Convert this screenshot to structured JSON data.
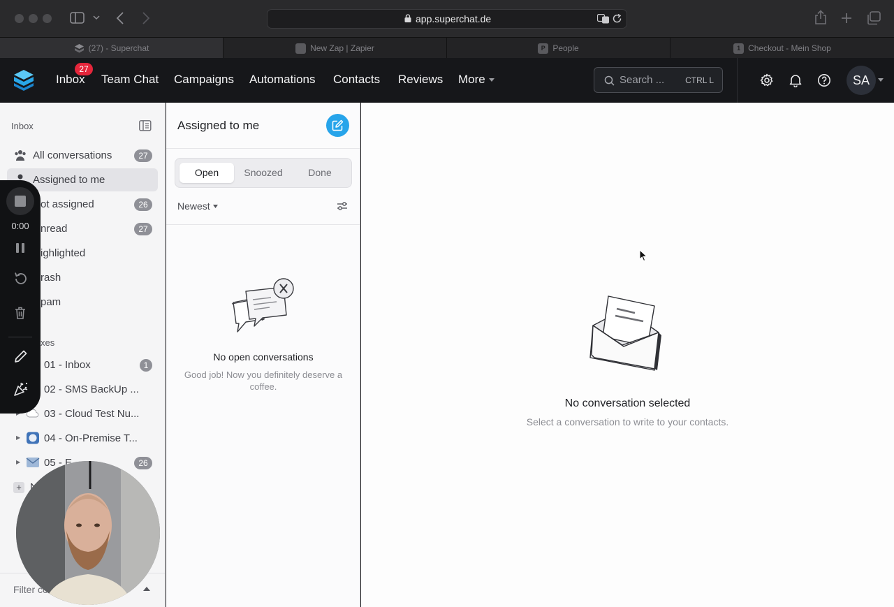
{
  "browser": {
    "url": "app.superchat.de",
    "tabs": [
      {
        "title": "(27) - Superchat",
        "favicon": "superchat-favicon"
      },
      {
        "title": "New Zap | Zapier",
        "favicon": "zapier-favicon"
      },
      {
        "title": "People",
        "favicon": "P"
      },
      {
        "title": "Checkout - Mein Shop",
        "favicon": "1"
      }
    ]
  },
  "header": {
    "nav": [
      {
        "label": "Inbox",
        "badge": "27"
      },
      {
        "label": "Team Chat"
      },
      {
        "label": "Campaigns"
      },
      {
        "label": "Automations"
      },
      {
        "label": "Contacts"
      },
      {
        "label": "Reviews"
      },
      {
        "label": "More"
      }
    ],
    "search_placeholder": "Search ...",
    "search_shortcut": "CTRL L",
    "avatar_initials": "SA"
  },
  "sidebar": {
    "title": "Inbox",
    "items": [
      {
        "label": "All conversations",
        "count": "27"
      },
      {
        "label": "Assigned to me",
        "count": ""
      },
      {
        "label": "ot assigned",
        "count": "26"
      },
      {
        "label": "nread",
        "count": "27"
      },
      {
        "label": "ighlighted",
        "count": ""
      },
      {
        "label": "rash",
        "count": ""
      },
      {
        "label": "pam",
        "count": ""
      }
    ],
    "inboxes_heading": "xes",
    "inboxes": [
      {
        "label": "01 - Inbox",
        "count": "1"
      },
      {
        "label": "02 - SMS BackUp ...",
        "count": ""
      },
      {
        "label": "03 - Cloud Test Nu...",
        "count": ""
      },
      {
        "label": "04 - On-Premise T...",
        "count": ""
      },
      {
        "label": "05 - E",
        "count": "26"
      }
    ],
    "add_label": "N",
    "filter_label": "Filter co"
  },
  "conversation_list": {
    "title": "Assigned to me",
    "tabs": [
      "Open",
      "Snoozed",
      "Done"
    ],
    "active_tab": "Open",
    "sort_label": "Newest",
    "empty_title": "No open conversations",
    "empty_text": "Good job! Now you definitely deserve a coffee."
  },
  "main": {
    "empty_title": "No conversation selected",
    "empty_text": "Select a conversation to write to your contacts."
  },
  "recorder": {
    "time": "0:00"
  },
  "colors": {
    "accent": "#27a4ea",
    "badge_red": "#e5263b",
    "header_bg": "#16171a"
  }
}
